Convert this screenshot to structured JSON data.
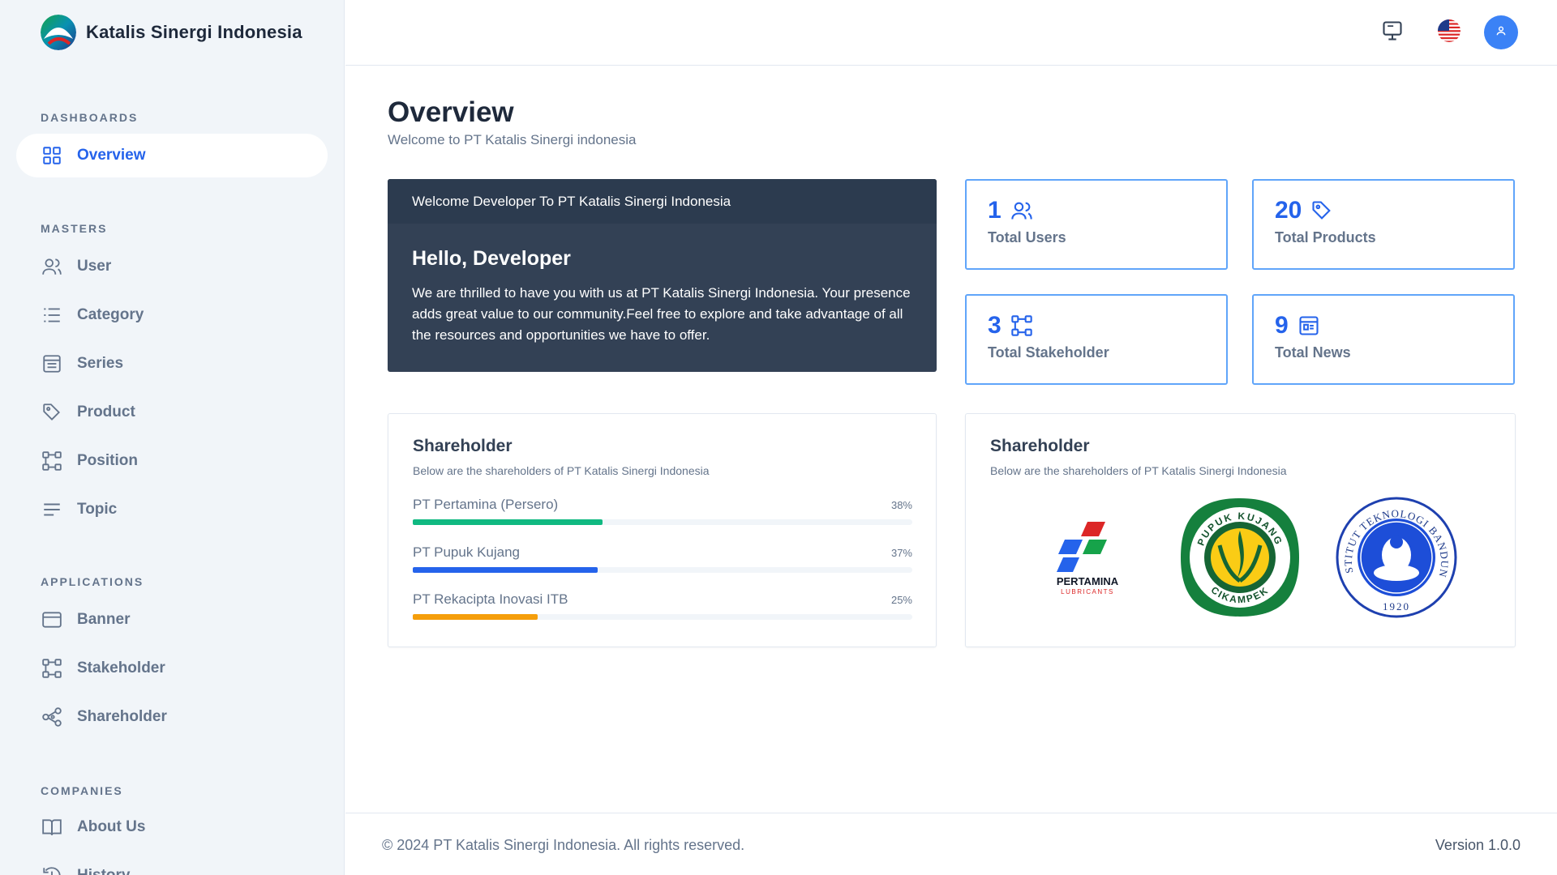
{
  "brand": {
    "name": "Katalis Sinergi Indonesia",
    "icon": "brand-logo"
  },
  "sidebar": {
    "sections": {
      "dashboards": "DASHBOARDS",
      "masters": "MASTERS",
      "applications": "APPLICATIONS",
      "companies": "COMPANIES"
    },
    "items": [
      {
        "label": "Overview",
        "icon": "grid-icon",
        "active": true
      },
      {
        "label": "User",
        "icon": "users-icon"
      },
      {
        "label": "Category",
        "icon": "list-icon"
      },
      {
        "label": "Series",
        "icon": "table-list-icon"
      },
      {
        "label": "Product",
        "icon": "tag-icon"
      },
      {
        "label": "Position",
        "icon": "nodes-icon"
      },
      {
        "label": "Topic",
        "icon": "lines-icon"
      },
      {
        "label": "Banner",
        "icon": "browser-icon"
      },
      {
        "label": "Stakeholder",
        "icon": "nodes-icon"
      },
      {
        "label": "Shareholder",
        "icon": "share-icon"
      },
      {
        "label": "About Us",
        "icon": "book-icon"
      },
      {
        "label": "History",
        "icon": "history-icon"
      }
    ]
  },
  "header": {
    "monitor_icon": "monitor-icon",
    "language_icon": "us-flag-icon",
    "avatar_icon": "user-icon"
  },
  "page": {
    "title": "Overview",
    "subtitle": "Welcome to PT Katalis Sinergi indonesia"
  },
  "welcome": {
    "header": "Welcome Developer To PT Katalis Sinergi Indonesia",
    "greeting": "Hello, Developer",
    "text": "We are thrilled to have you with us at PT Katalis Sinergi Indonesia. Your presence adds great value to our community.Feel free to explore and take advantage of all the resources and opportunities we have to offer."
  },
  "stats": [
    {
      "value": "1",
      "label": "Total Users",
      "icon": "users-icon"
    },
    {
      "value": "20",
      "label": "Total Products",
      "icon": "tag-icon"
    },
    {
      "value": "3",
      "label": "Total Stakeholder",
      "icon": "nodes-icon"
    },
    {
      "value": "9",
      "label": "Total News",
      "icon": "news-icon"
    }
  ],
  "shareholders": {
    "title": "Shareholder",
    "subtitle": "Below are the shareholders of PT Katalis Sinergi Indonesia",
    "items": [
      {
        "name": "PT Pertamina (Persero)",
        "percent": "38%",
        "value": 38,
        "color": "#10b981"
      },
      {
        "name": "PT Pupuk Kujang",
        "percent": "37%",
        "value": 37,
        "color": "#2563eb"
      },
      {
        "name": "PT Rekacipta Inovasi ITB",
        "percent": "25%",
        "value": 25,
        "color": "#f59e0b"
      }
    ]
  },
  "shareholder_logos": {
    "title": "Shareholder",
    "subtitle": "Below are the shareholders of PT Katalis Sinergi Indonesia",
    "pertamina": {
      "name": "PERTAMINA",
      "sub": "LUBRICANTS"
    },
    "kujang": {
      "top": "PUPUK KUJANG",
      "bottom": "CIKAMPEK"
    },
    "itb": {
      "ring": "INSTITUT TEKNOLOGI BANDUNG",
      "year": "1920"
    }
  },
  "footer": {
    "copyright": "© 2024 PT Katalis Sinergi Indonesia. All rights reserved.",
    "version": "Version 1.0.0"
  }
}
